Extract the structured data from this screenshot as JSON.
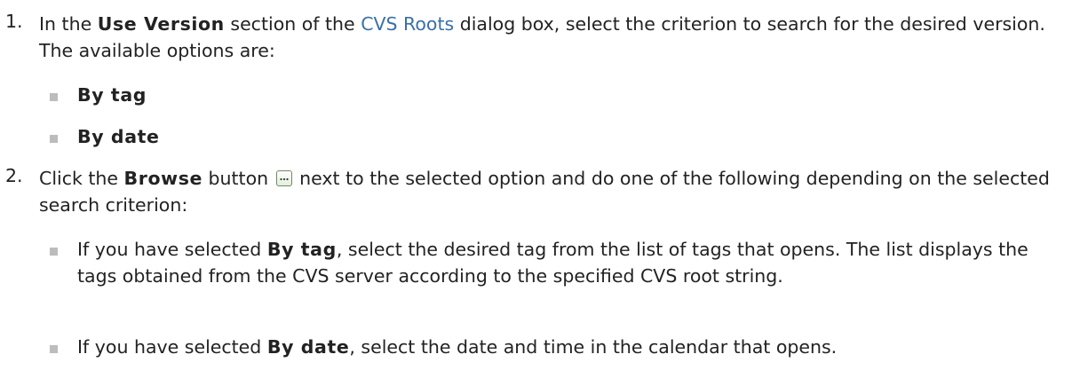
{
  "steps": [
    {
      "number": "1.",
      "prefix": "In the ",
      "bold": "Use Version",
      "middle": " section of the ",
      "link": "CVS Roots",
      "suffix": " dialog box, select the criterion to search for the desired version. The available options are:",
      "options": [
        "By tag",
        "By date"
      ]
    },
    {
      "number": "2.",
      "prefix": "Click the ",
      "bold": "Browse",
      "middle": " button ",
      "suffix": " next to the selected option and do one of the following depending on the selected search criterion:",
      "button_icon": "ellipsis-icon",
      "bullets": [
        {
          "prefix": "If you have selected ",
          "bold": "By tag",
          "suffix": ", select the desired tag from the list of tags that opens. The list displays the tags obtained from the CVS server according to the specified CVS root string."
        },
        {
          "prefix": "If you have selected ",
          "bold": "By date",
          "suffix": ", select the date and time in the calendar that opens."
        }
      ]
    }
  ],
  "colors": {
    "text": "#222222",
    "link": "#3a6fa8",
    "bullet": "#bcbcbc"
  }
}
